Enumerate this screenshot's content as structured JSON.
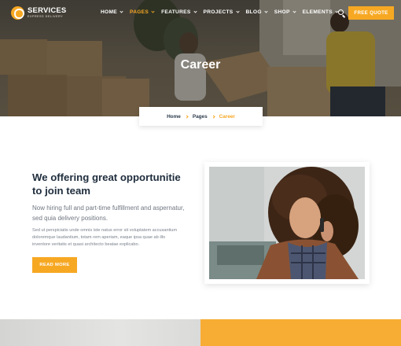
{
  "brand": {
    "name": "SERVICES",
    "tagline": "EXPRESS DELIVERY"
  },
  "nav": {
    "items": [
      {
        "label": "HOME",
        "active": false
      },
      {
        "label": "PAGES",
        "active": true
      },
      {
        "label": "FEATURES",
        "active": false
      },
      {
        "label": "PROJECTS",
        "active": false
      },
      {
        "label": "BLOG",
        "active": false
      },
      {
        "label": "SHOP",
        "active": false
      },
      {
        "label": "ELEMENTS",
        "active": false
      }
    ],
    "search_icon": "search-icon",
    "quote_button": "FREE QUOTE"
  },
  "hero": {
    "title": "Career"
  },
  "breadcrumb": {
    "home": "Home",
    "pages": "Pages",
    "current": "Career"
  },
  "content": {
    "heading": "We offering great opportunitie to join team",
    "lead": "Now hiring full and part-time fulfillment and aspernatur, sed quia delivery positions.",
    "body": "Sed ut perspiciatis unde omnis iste natus error sit voluptatem accusantium doloremque laudantium, totam rem aperiam, eaque ipsa quae ab illo inventore veritatis et quasi architecto beatae explicabo.",
    "button": "READ MORE"
  },
  "colors": {
    "accent": "#f7a823",
    "heading": "#1f2d3d",
    "text": "#6f7680"
  }
}
